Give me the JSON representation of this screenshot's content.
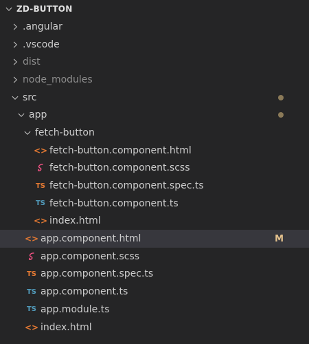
{
  "explorer": {
    "title": "ZD-BUTTON",
    "items": [
      {
        "label": ".angular",
        "type": "folder",
        "expanded": false,
        "depth": 1,
        "dim": false
      },
      {
        "label": ".vscode",
        "type": "folder",
        "expanded": false,
        "depth": 1,
        "dim": false
      },
      {
        "label": "dist",
        "type": "folder",
        "expanded": false,
        "depth": 1,
        "dim": true
      },
      {
        "label": "node_modules",
        "type": "folder",
        "expanded": false,
        "depth": 1,
        "dim": true
      },
      {
        "label": "src",
        "type": "folder",
        "expanded": true,
        "depth": 1,
        "dim": false,
        "badge": "dot"
      },
      {
        "label": "app",
        "type": "folder",
        "expanded": true,
        "depth": 2,
        "dim": false,
        "badge": "dot"
      },
      {
        "label": "fetch-button",
        "type": "folder",
        "expanded": true,
        "depth": 3,
        "dim": false
      },
      {
        "label": "fetch-button.component.html",
        "type": "file",
        "icon": "html",
        "depth": 4
      },
      {
        "label": "fetch-button.component.scss",
        "type": "file",
        "icon": "scss",
        "depth": 4
      },
      {
        "label": "fetch-button.component.spec.ts",
        "type": "file",
        "icon": "ts-spec",
        "depth": 4
      },
      {
        "label": "fetch-button.component.ts",
        "type": "file",
        "icon": "ts",
        "depth": 4
      },
      {
        "label": "index.html",
        "type": "file",
        "icon": "html",
        "depth": 4
      },
      {
        "label": "app.component.html",
        "type": "file",
        "icon": "html",
        "depth": 3,
        "selected": true,
        "badge": "M"
      },
      {
        "label": "app.component.scss",
        "type": "file",
        "icon": "scss",
        "depth": 3
      },
      {
        "label": "app.component.spec.ts",
        "type": "file",
        "icon": "ts-spec",
        "depth": 3
      },
      {
        "label": "app.component.ts",
        "type": "file",
        "icon": "ts",
        "depth": 3
      },
      {
        "label": "app.module.ts",
        "type": "file",
        "icon": "ts",
        "depth": 3
      },
      {
        "label": "index.html",
        "type": "file",
        "icon": "html",
        "depth": 3
      }
    ]
  },
  "icons": {
    "html": "<>",
    "ts": "TS",
    "ts-spec": "TS",
    "scss": "sass-icon"
  },
  "colors": {
    "background": "#252526",
    "selected": "#37373d",
    "html": "#e37933",
    "ts": "#519aba",
    "ts_spec": "#e37933",
    "scss": "#f55385",
    "modified": "#e2c08d"
  }
}
